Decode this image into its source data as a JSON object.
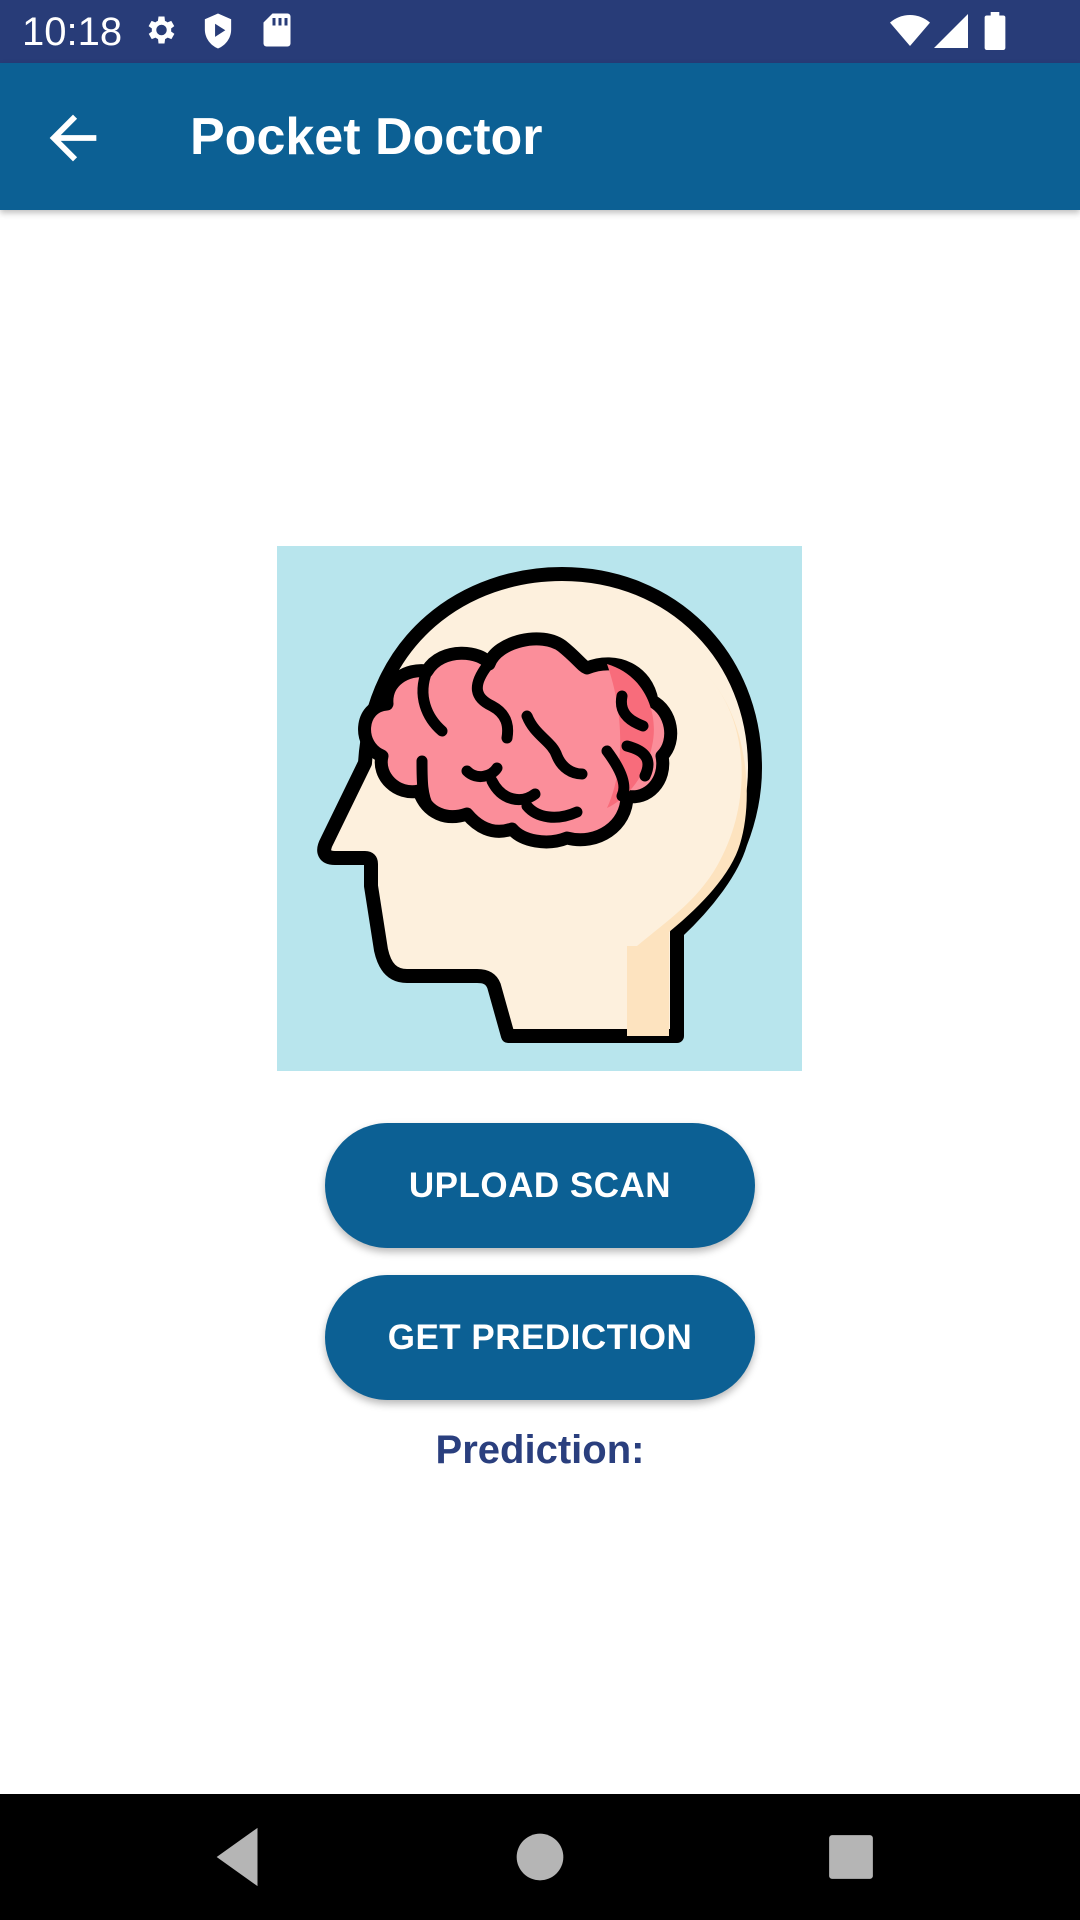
{
  "status_bar": {
    "time": "10:18",
    "icons": [
      "gear-icon",
      "shield-icon",
      "sd-card-icon",
      "wifi-icon",
      "signal-icon",
      "battery-icon"
    ],
    "background": "#283c78"
  },
  "app_bar": {
    "title": "Pocket Doctor",
    "back_icon": "arrow-back-icon",
    "background": "#0c6094"
  },
  "illustration": {
    "icon": "brain-head-icon",
    "background": "#b8e5ed"
  },
  "buttons": {
    "upload_label": "UPLOAD SCAN",
    "predict_label": "GET PREDICTION",
    "color": "#0c6094"
  },
  "result": {
    "label": "Prediction:",
    "color": "#2a3f7e"
  },
  "nav_bar": {
    "icons": [
      "back-triangle-icon",
      "home-circle-icon",
      "recents-square-icon"
    ]
  }
}
